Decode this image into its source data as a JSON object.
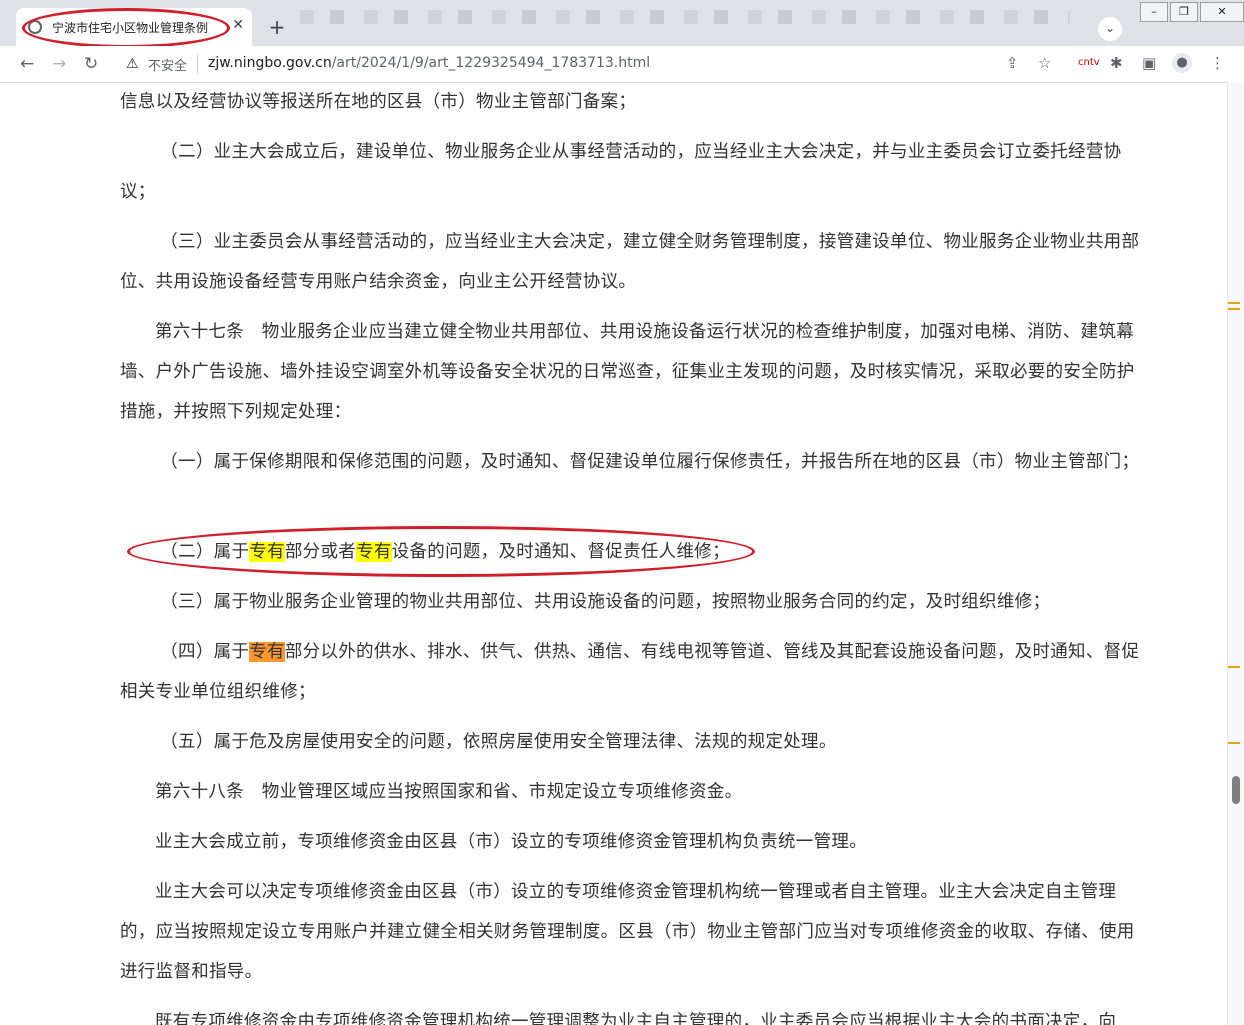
{
  "browser": {
    "tab_title": "宁波市住宅小区物业管理条例",
    "insecure_label": "不安全",
    "url_host": "zjw.ningbo.gov.cn",
    "url_path": "/art/2024/1/9/art_1229325494_1783713.html"
  },
  "paragraphs": {
    "p1": "信息以及经营协议等报送所在地的区县（市）物业主管部门备案；",
    "p2": "（二）业主大会成立后，建设单位、物业服务企业从事经营活动的，应当经业主大会决定，并与业主委员会订立委托经营协议；",
    "p3": "（三）业主委员会从事经营活动的，应当经业主大会决定，建立健全财务管理制度，接管建设单位、物业服务企业物业共用部位、共用设施设备经营专用账户结余资金，向业主公开经营协议。",
    "p4": "第六十七条　物业服务企业应当建立健全物业共用部位、共用设施设备运行状况的检查维护制度，加强对电梯、消防、建筑幕墙、户外广告设施、墙外挂设空调室外机等设备安全状况的日常巡查，征集业主发现的问题，及时核实情况，采取必要的安全防护措施，并按照下列规定处理：",
    "p5": "（一）属于保修期限和保修范围的问题，及时通知、督促建设单位履行保修责任，并报告所在地的区县（市）物业主管部门；",
    "p6_a": "（二）属于",
    "p6_hl1": "专有",
    "p6_b": "部分或者",
    "p6_hl2": "专有",
    "p6_c": "设备的问题，及时通知、督促责任人维修；",
    "p7": "（三）属于物业服务企业管理的物业共用部位、共用设施设备的问题，按照物业服务合同的约定，及时组织维修；",
    "p8_a": "（四）属于",
    "p8_hl": "专有",
    "p8_b": "部分以外的供水、排水、供气、供热、通信、有线电视等管道、管线及其配套设施设备问题，及时通知、督促相关专业单位组织维修；",
    "p9": "（五）属于危及房屋使用安全的问题，依照房屋使用安全管理法律、法规的规定处理。",
    "p10": "第六十八条　物业管理区域应当按照国家和省、市规定设立专项维修资金。",
    "p11": "业主大会成立前，专项维修资金由区县（市）设立的专项维修资金管理机构负责统一管理。",
    "p12": "业主大会可以决定专项维修资金由区县（市）设立的专项维修资金管理机构统一管理或者自主管理。业主大会决定自主管理的，应当按照规定设立专用账户并建立健全相关财务管理制度。区县（市）物业主管部门应当对专项维修资金的收取、存储、使用进行监督和指导。",
    "p13": "既有专项维修资金由专项维修资金管理机构统一管理调整为业主自主管理的，业主委员会应当根据业主大会的书面决定，向"
  },
  "colors": {
    "highlight_yellow": "#ffff00",
    "highlight_orange": "#ff9632",
    "annotation_red": "#d01f2a"
  }
}
